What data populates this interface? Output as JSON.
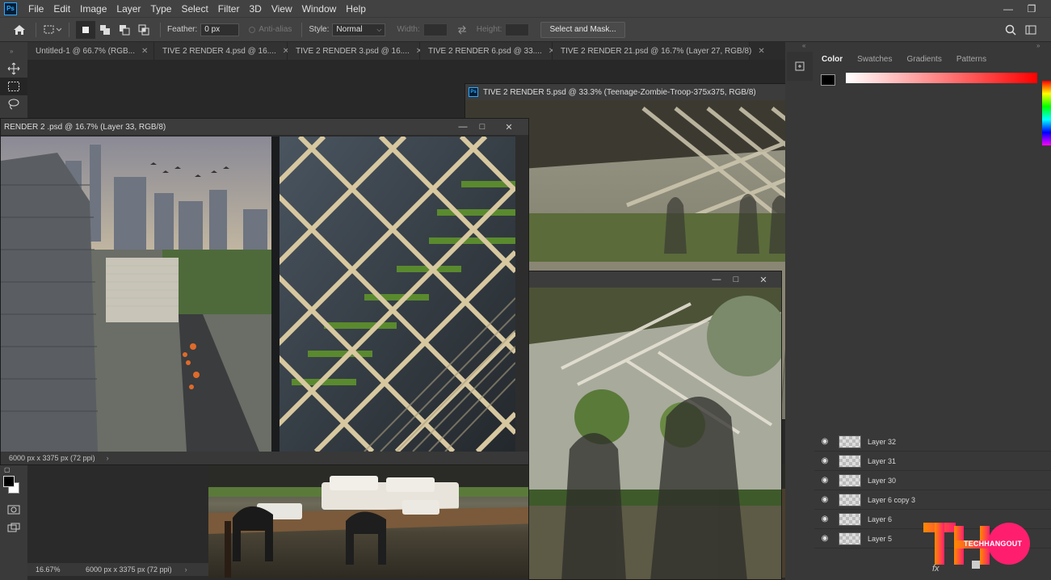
{
  "menu": {
    "logo": "Ps",
    "items": [
      "File",
      "Edit",
      "Image",
      "Layer",
      "Type",
      "Select",
      "Filter",
      "3D",
      "View",
      "Window",
      "Help"
    ]
  },
  "options": {
    "feather_label": "Feather:",
    "feather_value": "0 px",
    "antialias_label": "Anti-alias",
    "style_label": "Style:",
    "style_value": "Normal",
    "width_label": "Width:",
    "height_label": "Height:",
    "select_mask_label": "Select and Mask..."
  },
  "tabs": [
    {
      "label": "Untitled-1 @ 66.7% (RGB..."
    },
    {
      "label": "TIVE 2 RENDER 4.psd @ 16...."
    },
    {
      "label": "TIVE 2 RENDER 3.psd @ 16...."
    },
    {
      "label": "TIVE 2 RENDER 6.psd @ 33...."
    },
    {
      "label": "TIVE 2 RENDER 21.psd @ 16.7% (Layer 27, RGB/8)"
    }
  ],
  "windows": {
    "render2": {
      "title": "RENDER 2 .psd @ 16.7% (Layer 33, RGB/8)",
      "status": "6000 px x 3375 px (72 ppi)"
    },
    "render5": {
      "title": "TIVE 2 RENDER 5.psd @ 33.3% (Teenage-Zombie-Troop-375x375, RGB/8)"
    },
    "bottom": {
      "zoom": "16.67%",
      "status": "6000 px x 3375 px (72 ppi)"
    }
  },
  "color_panel": {
    "tabs": [
      "Color",
      "Swatches",
      "Gradients",
      "Patterns"
    ],
    "gradient_from": "#ffffff",
    "gradient_to": "#ff0000"
  },
  "layers": [
    {
      "name": "Layer 32"
    },
    {
      "name": "Layer 31"
    },
    {
      "name": "Layer 30"
    },
    {
      "name": "Layer 6 copy 3"
    },
    {
      "name": "Layer 6"
    },
    {
      "name": "Layer 5"
    }
  ],
  "watermark": {
    "letters": "THO",
    "text": "TECHHANGOUT",
    "color_from": "#ff8a00",
    "color_to": "#ff1e6e"
  }
}
